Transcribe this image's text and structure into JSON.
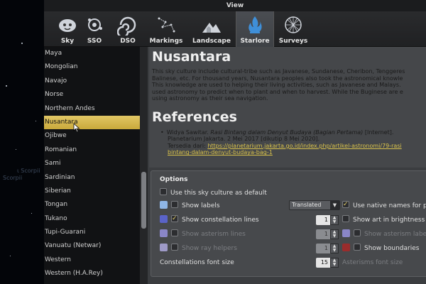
{
  "window": {
    "title": "View"
  },
  "tabs": [
    {
      "label": "Sky",
      "icon": "sky-icon"
    },
    {
      "label": "SSO",
      "icon": "sso-icon"
    },
    {
      "label": "DSO",
      "icon": "dso-icon"
    },
    {
      "label": "Markings",
      "icon": "markings-icon"
    },
    {
      "label": "Landscape",
      "icon": "landscape-icon"
    },
    {
      "label": "Starlore",
      "icon": "starlore-icon",
      "active": true
    },
    {
      "label": "Surveys",
      "icon": "surveys-icon"
    }
  ],
  "sky_background": {
    "labels": [
      "ι Scorpii",
      "Scorpii"
    ]
  },
  "culture_list": {
    "items": [
      "Maya",
      "Mongolian",
      "Navajo",
      "Norse",
      "Northern Andes",
      "Nusantara",
      "Ojibwe",
      "Romanian",
      "Sami",
      "Sardinian",
      "Siberian",
      "Tongan",
      "Tukano",
      "Tupi-Guarani",
      "Vanuatu (Netwar)",
      "Western",
      "Western (H.A.Rey)"
    ],
    "selected": "Nusantara"
  },
  "description": {
    "title": "Nusantara",
    "lines": [
      "This sky culture include cultural-tribe such as Javanese, Sundanese, Cheribon, Tenggeres",
      "Balinese, etc. For thousand years, Nusantara peoples also took the astronomical knowle",
      "This knowledge are used to helping their living activities, such as Javanese and Malays.",
      "used astronomy to predict when to plant and when to harvest. While the Buginese are e",
      "using astronomy as their sea navigation."
    ],
    "references_title": "References",
    "reference": {
      "bullet": "•",
      "author": "Widya Sawitar.",
      "title": "Rasi Bintang dalam Denyut Budaya (Bagian Pertama)",
      "rest1": " [Internet].",
      "line2": "Planetarium Jakarta. 2 Mei 2017 [dikutip 8 Mei 2020].",
      "line3_prefix": "Tersedia dari: ",
      "link1": "https://planetarium.jakarta.go.id/index.php/artikel-astronomi/79-rasi",
      "link2": "bintang-dalam-denyut-budaya-bag-1"
    }
  },
  "options": {
    "title": "Options",
    "use_default": {
      "label": "Use this sky culture as default",
      "checked": false
    },
    "show_labels": {
      "label": "Show labels",
      "checked": false,
      "color": "#8fb6e6"
    },
    "labels_style": {
      "value": "Translated"
    },
    "native_names": {
      "label": "Use native names for pla",
      "checked": true
    },
    "constellation_lines": {
      "label": "Show constellation lines",
      "checked": true,
      "color": "#5a63c8",
      "width": "1"
    },
    "art_brightness": {
      "label": "Show art in brightness",
      "checked": false
    },
    "asterism_lines": {
      "label": "Show asterism lines",
      "checked": false,
      "color": "#8a86c8",
      "width": "1"
    },
    "asterism_labels": {
      "label": "Show asterism label",
      "checked": false,
      "color": "#8a86c8"
    },
    "ray_helpers": {
      "label": "Show ray helpers",
      "checked": false,
      "color": "#9e9ac8",
      "width": "1"
    },
    "boundaries": {
      "label": "Show boundaries",
      "checked": false,
      "color": "#9a2c2c"
    },
    "const_font": {
      "label": "Constellations font size",
      "value": "15"
    },
    "asterism_font": {
      "label": "Asterisms font size"
    }
  }
}
